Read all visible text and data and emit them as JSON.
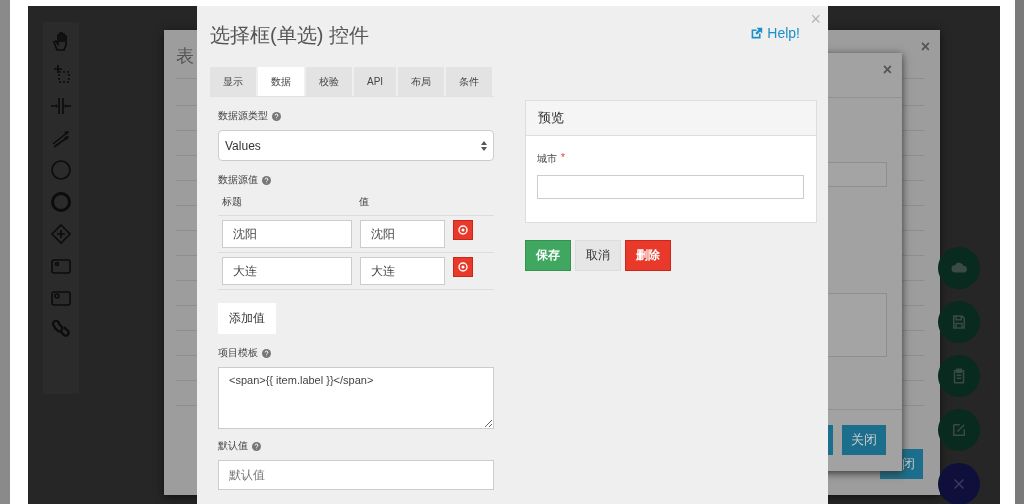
{
  "back_dialog": {
    "title": "表",
    "close": "×",
    "button": "闭"
  },
  "inner_dialog": {
    "close": "×",
    "button": "关闭"
  },
  "dialog": {
    "title": "选择框(单选) 控件",
    "close": "×",
    "help": "Help!",
    "tabs": [
      {
        "label": "显示",
        "selected": false
      },
      {
        "label": "数据",
        "selected": true
      },
      {
        "label": "校验",
        "selected": false
      },
      {
        "label": "API",
        "selected": false
      },
      {
        "label": "布局",
        "selected": false
      },
      {
        "label": "条件",
        "selected": false
      }
    ],
    "source_type": {
      "label": "数据源类型",
      "value": "Values"
    },
    "source_values": {
      "label": "数据源值",
      "columns": [
        "标题",
        "值"
      ],
      "rows": [
        {
          "label": "沈阳",
          "value": "沈阳"
        },
        {
          "label": "大连",
          "value": "大连"
        }
      ],
      "add_button": "添加值"
    },
    "template": {
      "label": "项目模板",
      "value": "<span>{{ item.label }}</span>"
    },
    "default_value": {
      "label": "默认值",
      "placeholder": "默认值"
    },
    "preview": {
      "title": "预览",
      "field_label": "城市",
      "required_mark": "*"
    },
    "buttons": [
      {
        "label": "保存",
        "kind": "save"
      },
      {
        "label": "取消",
        "kind": "cancel"
      },
      {
        "label": "删除",
        "kind": "delete"
      }
    ]
  }
}
